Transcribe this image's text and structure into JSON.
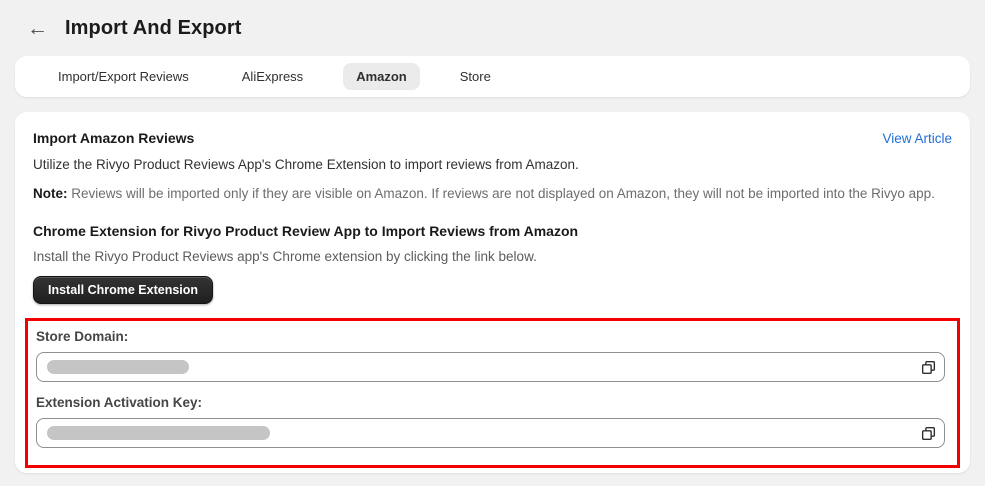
{
  "header": {
    "title": "Import And Export",
    "back_icon_glyph": "←"
  },
  "tabs": [
    {
      "label": "Import/Export Reviews",
      "active": false
    },
    {
      "label": "AliExpress",
      "active": false
    },
    {
      "label": "Amazon",
      "active": true
    },
    {
      "label": "Store",
      "active": false
    }
  ],
  "panel": {
    "title": "Import Amazon Reviews",
    "view_article_label": "View Article",
    "intro": "Utilize the Rivyo Product Reviews App's Chrome Extension to import reviews from Amazon.",
    "note_label": "Note:",
    "note_text": " Reviews will be imported only if they are visible on Amazon. If reviews are not displayed on Amazon, they will not be imported into the Rivyo app.",
    "extension_heading": "Chrome Extension for Rivyo Product Review App to Import Reviews from Amazon",
    "extension_text": "Install the Rivyo Product Reviews app's Chrome extension by clicking the link below.",
    "install_button_label": "Install Chrome Extension",
    "fields": [
      {
        "label": "Store Domain:",
        "value": "",
        "redacted": true,
        "copy_icon": "copy-icon"
      },
      {
        "label": "Extension Activation Key:",
        "value": "",
        "redacted": true,
        "copy_icon": "copy-icon"
      }
    ],
    "highlight_border_color": "#f40000"
  },
  "colors": {
    "page_background": "#f1f1f1",
    "card_background": "#ffffff",
    "active_tab_background": "#ebebeb",
    "link_blue": "#1f6fd6",
    "button_black": "#1f1f1f",
    "redaction_gray": "#c5c5c5",
    "highlight_red": "#f40000"
  }
}
